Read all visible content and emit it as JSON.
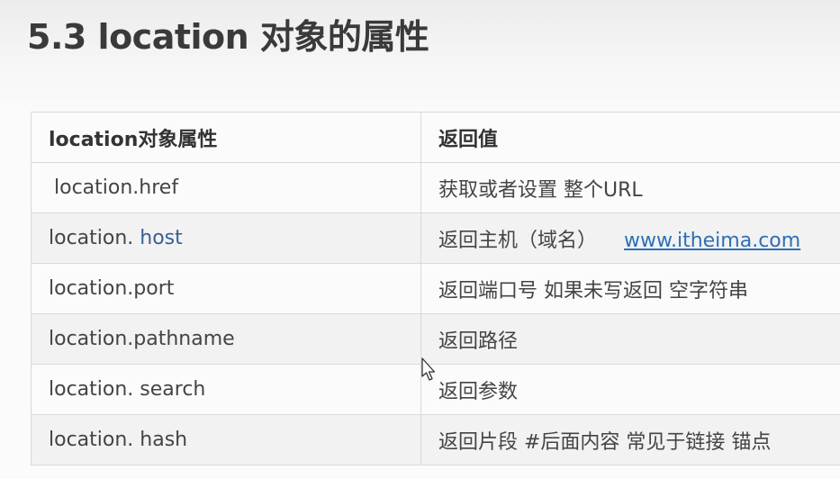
{
  "title": "5.3 location 对象的属性",
  "table": {
    "headers": [
      "location对象属性",
      "返回值"
    ],
    "rows": [
      {
        "prop": " location.href",
        "value": "获取或者设置 整个URL"
      },
      {
        "prop_prefix": "location. ",
        "prop_highlight": "host",
        "value": "返回主机（域名）",
        "link": "www.itheima.com"
      },
      {
        "prop": "location.port",
        "value": "返回端口号   如果未写返回 空字符串"
      },
      {
        "prop": "location.pathname",
        "value": "返回路径"
      },
      {
        "prop": "location. search",
        "value": "返回参数"
      },
      {
        "prop": "location. hash",
        "value": "返回片段   #后面内容 常见于链接 锚点"
      }
    ]
  },
  "icons": {
    "cursor": "mouse-pointer-icon"
  }
}
